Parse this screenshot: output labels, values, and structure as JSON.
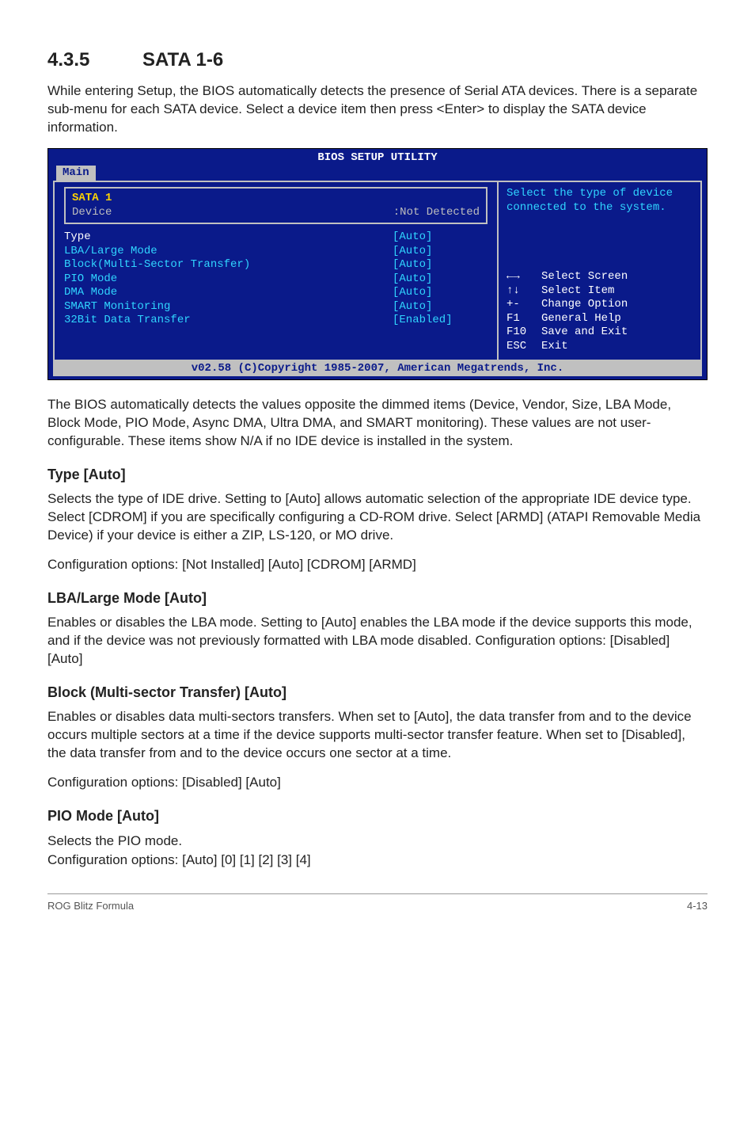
{
  "section": {
    "number": "4.3.5",
    "title": "SATA 1-6"
  },
  "intro": "While entering Setup, the BIOS automatically detects the presence of Serial ATA devices. There is a separate sub-menu for each SATA device. Select a device item then press <Enter> to display the SATA device information.",
  "bios": {
    "title": "BIOS SETUP UTILITY",
    "tab": "Main",
    "panel_title": "SATA 1",
    "device_label": "Device",
    "device_value": ":Not Detected",
    "rows": [
      {
        "label": "Type",
        "value": "[Auto]"
      },
      {
        "label": "LBA/Large Mode",
        "value": "[Auto]"
      },
      {
        "label": "Block(Multi-Sector Transfer)",
        "value": "[Auto]"
      },
      {
        "label": "PIO Mode",
        "value": "[Auto]"
      },
      {
        "label": "DMA Mode",
        "value": "[Auto]"
      },
      {
        "label": "SMART Monitoring",
        "value": "[Auto]"
      },
      {
        "label": "32Bit Data Transfer",
        "value": "[Enabled]"
      }
    ],
    "help": "Select the type of device connected to the system.",
    "nav": [
      {
        "key": "←→",
        "action": "Select Screen"
      },
      {
        "key": "↑↓",
        "action": "Select Item"
      },
      {
        "key": "+-",
        "action": "Change Option"
      },
      {
        "key": "F1",
        "action": "General Help"
      },
      {
        "key": "F10",
        "action": "Save and Exit"
      },
      {
        "key": "ESC",
        "action": "Exit"
      }
    ],
    "footer": "v02.58 (C)Copyright 1985-2007, American Megatrends, Inc."
  },
  "after_bios": "The BIOS automatically detects the values opposite the dimmed items (Device, Vendor, Size, LBA Mode, Block Mode, PIO Mode, Async DMA, Ultra DMA, and SMART monitoring). These values are not user-configurable. These items show N/A if no IDE device is installed in the system.",
  "type": {
    "heading": "Type [Auto]",
    "p1": "Selects the type of IDE drive. Setting to [Auto] allows automatic selection of the appropriate IDE device type. Select [CDROM] if you are specifically configuring a CD-ROM drive. Select [ARMD] (ATAPI Removable Media Device) if your device is either a ZIP, LS-120, or MO drive.",
    "p2": "Configuration options: [Not Installed] [Auto] [CDROM] [ARMD]"
  },
  "lba": {
    "heading": "LBA/Large Mode [Auto]",
    "p": "Enables or disables the LBA mode. Setting to [Auto] enables the LBA mode if the device supports this mode, and if the device was not previously formatted with LBA mode disabled. Configuration options: [Disabled] [Auto]"
  },
  "block": {
    "heading": "Block (Multi-sector Transfer) [Auto]",
    "p1": "Enables or disables data multi-sectors transfers. When set to [Auto], the data transfer from and to the device occurs multiple sectors at a time if the device supports multi-sector transfer feature. When set to [Disabled], the data transfer from and to the device occurs one sector at a time.",
    "p2": "Configuration options: [Disabled] [Auto]"
  },
  "pio": {
    "heading": "PIO Mode [Auto]",
    "p1": "Selects the PIO mode.",
    "p2": "Configuration options: [Auto] [0] [1] [2] [3] [4]"
  },
  "footer": {
    "left": "ROG Blitz Formula",
    "right": "4-13"
  }
}
